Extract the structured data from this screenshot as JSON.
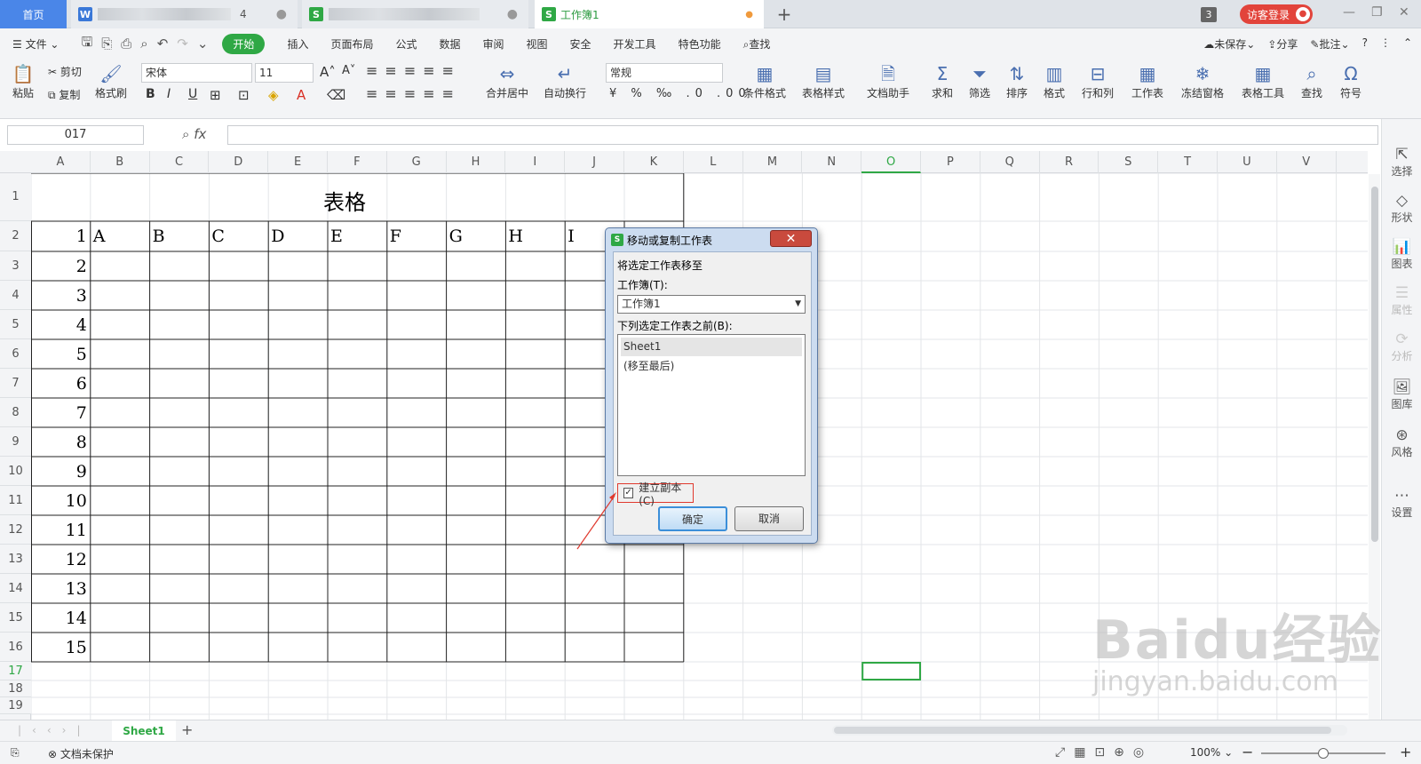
{
  "titlebar": {
    "home_tab": "首页",
    "tab1_suffix": "4",
    "wb_tab": "工作簿1",
    "new_tab": "+",
    "counter": "3",
    "login": "访客登录"
  },
  "menu": {
    "file": "文件",
    "items": [
      "开始",
      "插入",
      "页面布局",
      "公式",
      "数据",
      "审阅",
      "视图",
      "安全",
      "开发工具",
      "特色功能"
    ],
    "search": "查找",
    "unsaved": "未保存",
    "share": "分享",
    "comment": "批注"
  },
  "toolbar": {
    "paste": "粘贴",
    "cut": "剪切",
    "copy": "复制",
    "format_painter": "格式刷",
    "font": "宋体",
    "size": "11",
    "merge": "合并居中",
    "wrap": "自动换行",
    "numfmt": "常规",
    "cond_format": "条件格式",
    "table_style": "表格样式",
    "doc_helper": "文档助手",
    "sum": "求和",
    "filter": "筛选",
    "sort": "排序",
    "format": "格式",
    "rowcol": "行和列",
    "worksheet": "工作表",
    "freeze": "冻结窗格",
    "table_tools": "表格工具",
    "find": "查找",
    "symbol": "符号"
  },
  "formula": {
    "namebox": "017",
    "fx": "fx"
  },
  "columns": [
    "A",
    "B",
    "C",
    "D",
    "E",
    "F",
    "G",
    "H",
    "I",
    "J",
    "K",
    "L",
    "M",
    "N",
    "O",
    "P",
    "Q",
    "R",
    "S",
    "T",
    "U",
    "V"
  ],
  "rows": [
    "1",
    "2",
    "3",
    "4",
    "5",
    "6",
    "7",
    "8",
    "9",
    "10",
    "11",
    "12",
    "13",
    "14",
    "15",
    "16",
    "17",
    "18",
    "19"
  ],
  "table": {
    "title": "表格",
    "header": [
      "A",
      "B",
      "C",
      "D",
      "E",
      "F",
      "G",
      "H",
      "I"
    ],
    "numbers": [
      "1",
      "2",
      "3",
      "4",
      "5",
      "6",
      "7",
      "8",
      "9",
      "10",
      "11",
      "12",
      "13",
      "14",
      "15"
    ]
  },
  "sidebar": [
    "选择",
    "形状",
    "图表",
    "属性",
    "分析",
    "图库",
    "风格",
    "设置"
  ],
  "sheet_tab": "Sheet1",
  "status": {
    "protect": "文档未保护",
    "zoom": "100%"
  },
  "dialog": {
    "title": "移动或复制工作表",
    "move_label": "将选定工作表移至",
    "workbook_label": "工作簿(T):",
    "workbook_value": "工作簿1",
    "before_label": "下列选定工作表之前(B):",
    "sheets": [
      "Sheet1",
      "(移至最后)"
    ],
    "copy_label": "建立副本(C)",
    "ok": "确定",
    "cancel": "取消"
  },
  "watermark": {
    "brand": "Baidu经验",
    "url": "jingyan.baidu.com"
  }
}
